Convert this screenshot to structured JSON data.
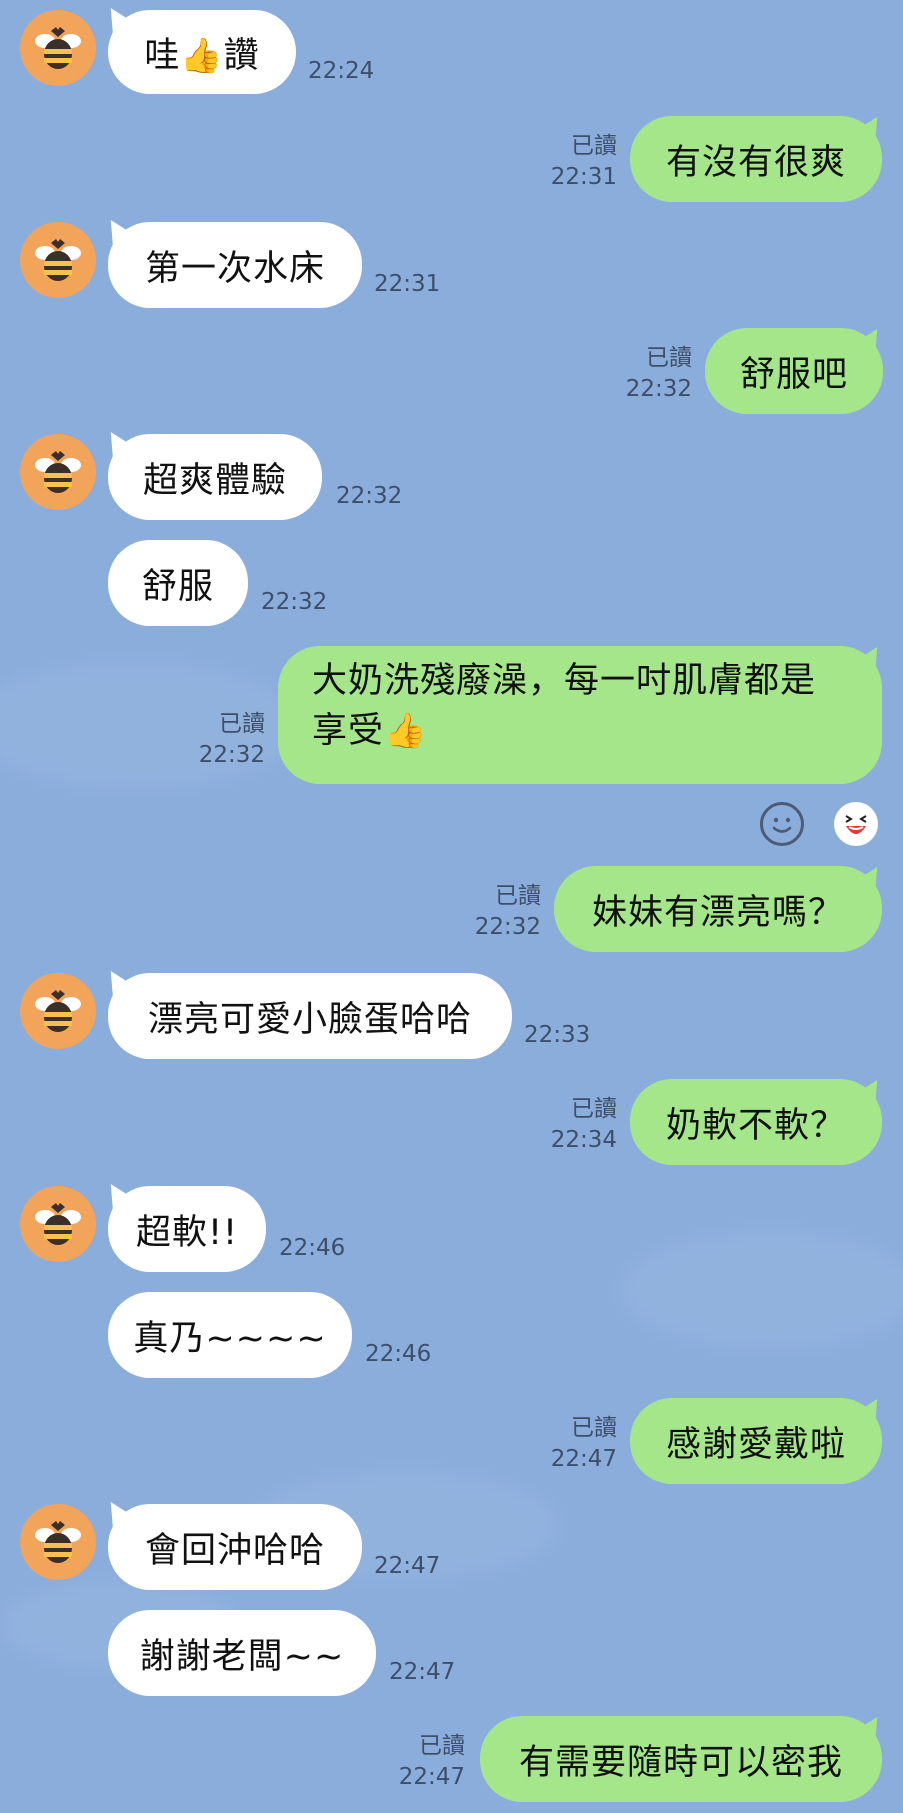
{
  "chat": {
    "read_label": "已讀",
    "messages": [
      {
        "side": "in",
        "text": "哇👍讚",
        "time": "22:24"
      },
      {
        "side": "out",
        "text": "有沒有很爽",
        "time": "22:31"
      },
      {
        "side": "in",
        "text": "第一次水床",
        "time": "22:31"
      },
      {
        "side": "out",
        "text": "舒服吧",
        "time": "22:32"
      },
      {
        "side": "in",
        "text": "超爽體驗",
        "time": "22:32"
      },
      {
        "side": "in",
        "text": "舒服",
        "time": "22:32"
      },
      {
        "side": "out",
        "text": "大奶洗殘廢澡，每一吋肌膚都是享受👍",
        "time": "22:32"
      },
      {
        "side": "out",
        "text": "妹妹有漂亮嗎？",
        "time": "22:32"
      },
      {
        "side": "in",
        "text": "漂亮可愛小臉蛋哈哈",
        "time": "22:33"
      },
      {
        "side": "out",
        "text": "奶軟不軟？",
        "time": "22:34"
      },
      {
        "side": "in",
        "text": "超軟!!",
        "time": "22:46"
      },
      {
        "side": "in",
        "text": "真乃~~~~",
        "time": "22:46"
      },
      {
        "side": "out",
        "text": "感謝愛戴啦",
        "time": "22:47"
      },
      {
        "side": "in",
        "text": "會回沖哈哈",
        "time": "22:47"
      },
      {
        "side": "in",
        "text": "謝謝老闆~~",
        "time": "22:47"
      },
      {
        "side": "out",
        "text": "有需要隨時可以密我",
        "time": "22:47"
      }
    ],
    "multiline_parts": {
      "line1": "大奶洗殘廢澡，每一吋肌膚都是",
      "line2": "享受",
      "emoji": "👍"
    },
    "first_parts": {
      "pre": "哇",
      "emoji": "👍",
      "post": "讚"
    }
  },
  "reactions": {
    "smile_icon": "smile-face-icon",
    "laugh_icon": "laughing-face-icon"
  },
  "avatar_icon": "bee-icon",
  "colors": {
    "background": "#8aaddc",
    "incoming_bubble": "#ffffff",
    "outgoing_bubble": "#a6e68b",
    "meta_text": "#3d4f68",
    "avatar": "#f2a45a"
  }
}
